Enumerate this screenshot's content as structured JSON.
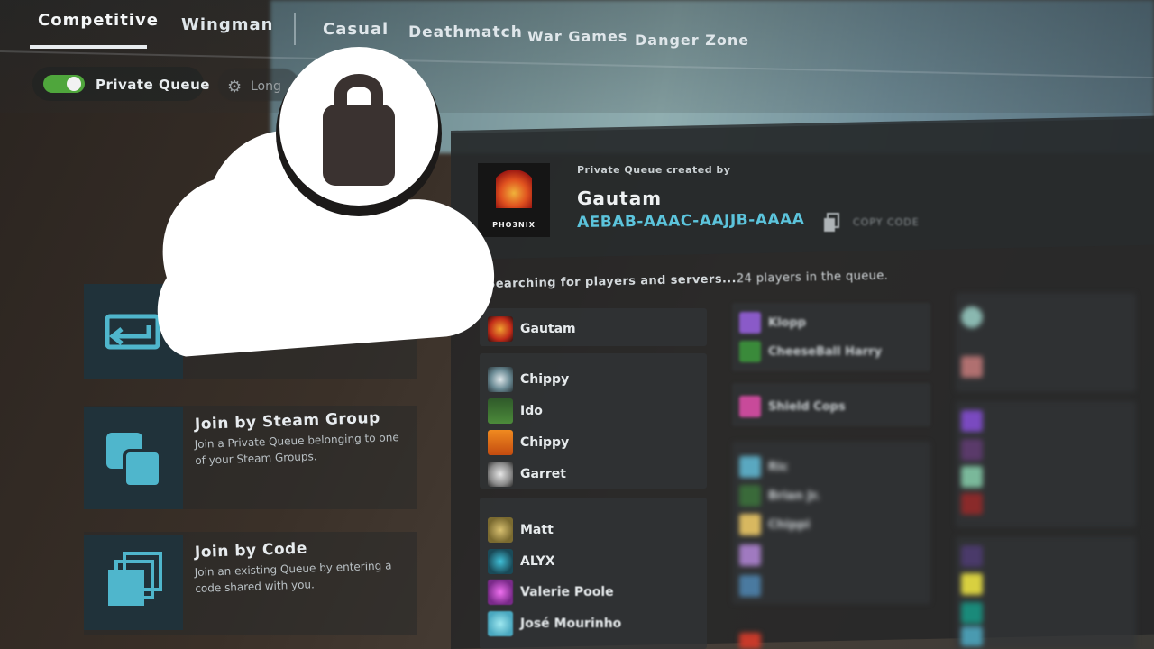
{
  "tabs": {
    "competitive": "Competitive",
    "wingman": "Wingman",
    "casual": "Casual",
    "deathmatch": "Deathmatch",
    "war_games": "War Games",
    "danger_zone": "Danger Zone"
  },
  "toolbar": {
    "private_queue_label": "Private Queue",
    "private_queue_on": true,
    "second_option_label": "Long"
  },
  "left_cards": [
    {
      "title": "Join by Steam Group",
      "desc": "Join a Private Queue belonging to one of your Steam Groups."
    },
    {
      "title": "Join by Code",
      "desc": "Join an existing Queue by entering a code shared with you."
    }
  ],
  "queue": {
    "logo_text": "PHO3NIX",
    "created_by": "Private Queue created by",
    "owner": "Gautam",
    "code": "AEBAB-AAAC-AAJJB-AAAA",
    "copy_label": "COPY CODE",
    "searching": "Searching for players and servers...",
    "player_count": "24 players in the queue."
  },
  "groups": {
    "leader": [
      "Gautam"
    ],
    "group2": [
      "Chippy",
      "Ido",
      "Chippy",
      "Garret"
    ],
    "group3": [
      "Matt",
      "ALYX",
      "Valerie Poole",
      "José Mourinho"
    ],
    "col2_a": [
      "Klopp",
      "CheeseBall Harry"
    ],
    "col2_b": [
      "Shield Cops"
    ],
    "col2_c": [
      "Ric",
      "Brian Jr.",
      "Chippi"
    ]
  },
  "colors": {
    "accent_cyan": "#5cc4dc",
    "toggle_on": "#4fa63c"
  },
  "overlay_icon": "cloud-lock-icon"
}
